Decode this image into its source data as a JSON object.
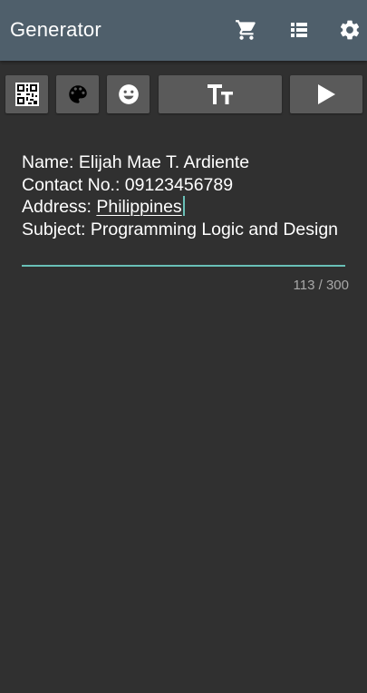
{
  "app_bar": {
    "title": "Generator",
    "icons": [
      "cart-icon",
      "list-icon",
      "settings-icon"
    ],
    "background": "#4f5f6b"
  },
  "toolbar": {
    "buttons": [
      {
        "name": "qr-code-button",
        "icon": "qr-code-icon"
      },
      {
        "name": "palette-button",
        "icon": "palette-icon"
      },
      {
        "name": "emoji-button",
        "icon": "emoji-icon"
      },
      {
        "name": "text-size-button",
        "icon": "text-size-icon"
      },
      {
        "name": "play-button",
        "icon": "play-icon"
      }
    ]
  },
  "editor": {
    "line1": "Name: Elijah Mae T. Ardiente",
    "line2": "Contact No.: 09123456789",
    "line3_prefix": "Address: ",
    "line3_word": "Philippines",
    "line4": "Subject: Programming Logic and Design",
    "accent_color": "#69c0b7"
  },
  "counter": "113 / 300"
}
